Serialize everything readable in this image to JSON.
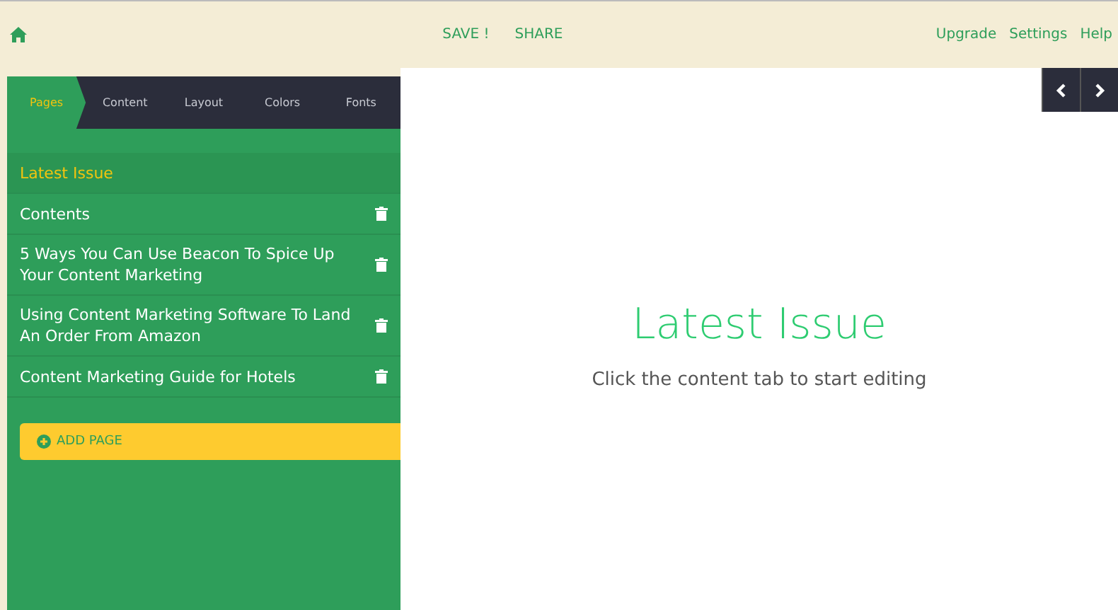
{
  "top_bar": {
    "actions": [
      "SAVE !",
      "SHARE"
    ],
    "links": [
      "Upgrade",
      "Settings",
      "Help"
    ]
  },
  "tabs": [
    {
      "label": "Pages",
      "selected": true
    },
    {
      "label": "Content",
      "selected": false
    },
    {
      "label": "Layout",
      "selected": false
    },
    {
      "label": "Colors",
      "selected": false
    },
    {
      "label": "Fonts",
      "selected": false
    }
  ],
  "pages": [
    {
      "title": "Latest Issue",
      "selected": true,
      "deletable": false
    },
    {
      "title": "Contents",
      "selected": false,
      "deletable": true
    },
    {
      "title": "5 Ways You Can Use Beacon To Spice Up Your Content Marketing",
      "selected": false,
      "deletable": true
    },
    {
      "title": "Using Content Marketing Software To Land An Order From Amazon",
      "selected": false,
      "deletable": true
    },
    {
      "title": "Content Marketing Guide for Hotels",
      "selected": false,
      "deletable": true
    }
  ],
  "add_page_button": "ADD PAGE",
  "preview": {
    "title": "Latest Issue",
    "subtitle": "Click the content tab to start editing"
  }
}
